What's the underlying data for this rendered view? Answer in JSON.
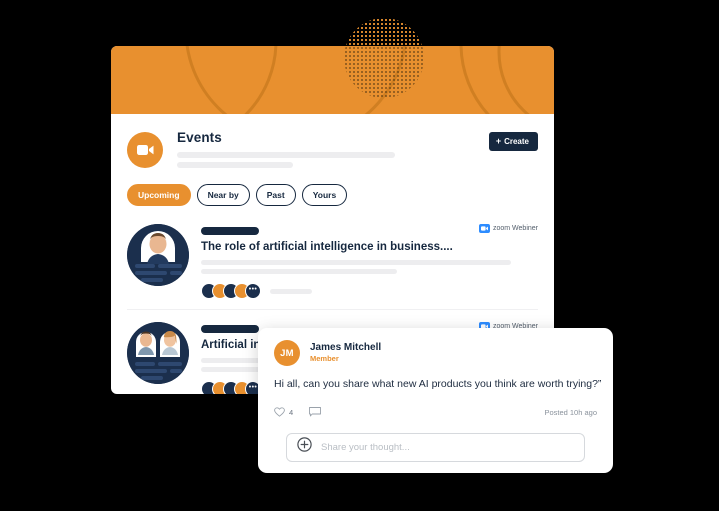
{
  "theme": {
    "accent_orange": "#E8902F",
    "navy": "#16283f",
    "zoom_blue": "#2D8CFF",
    "placeholder_gray": "#ededef"
  },
  "header": {
    "title": "Events",
    "logo_icon": "video-camera-icon",
    "create_button": {
      "label": "Create",
      "plus": "+"
    }
  },
  "tabs": [
    {
      "label": "Upcoming",
      "active": true
    },
    {
      "label": "Near by",
      "active": false
    },
    {
      "label": "Past",
      "active": false
    },
    {
      "label": "Yours",
      "active": false
    }
  ],
  "events": [
    {
      "title": "The role of artificial intelligence in business....",
      "badge": "zoom Webiner",
      "badge_icon": "zoom-icon"
    },
    {
      "title": "Artificial intelligences the industry!",
      "badge": "zoom Webiner",
      "badge_icon": "zoom-icon"
    }
  ],
  "comment": {
    "avatar_initials": "JM",
    "author": "James Mitchell",
    "role": "Member",
    "body": "Hi all, can you share what new AI products you think are worth trying?”",
    "like_icon": "heart-icon",
    "like_count": "4",
    "comment_icon": "comment-icon",
    "posted": "Posted 10h ago",
    "composer": {
      "add_icon": "plus-circle-icon",
      "placeholder": "Share your thought..."
    }
  }
}
